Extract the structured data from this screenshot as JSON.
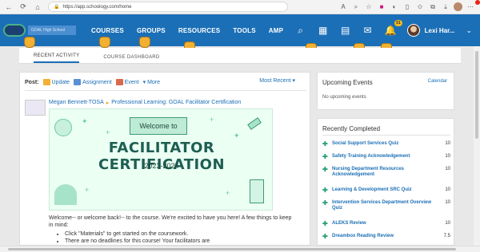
{
  "browser": {
    "url": "https://app.schoology.com/home",
    "nav": {
      "back": "←",
      "refresh": "⟳",
      "home": "⌂"
    }
  },
  "header": {
    "logo_text": "GOAL High School",
    "nav": [
      "COURSES",
      "GROUPS",
      "RESOURCES",
      "TOOLS",
      "AMP"
    ],
    "notification_count": "51",
    "user_name": "Lexi Har..."
  },
  "tabs": [
    "RECENT ACTIVITY",
    "COURSE DASHBOARD"
  ],
  "post": {
    "label": "Post:",
    "update": "Update",
    "assignment": "Assignment",
    "event": "Event",
    "more": "More",
    "sort": "Most Recent",
    "author": "Megan Bennett-TOSA",
    "arrow": "▸",
    "target": "Professional Learning: GOAL Facilitator Certification",
    "image": {
      "welcome": "Welcome to",
      "title": "FACILITATOR CERTIFICATION",
      "years": "2023-2024"
    },
    "intro": "Welcome-- or welcome back!-- to the course. We're excited to have you here! A few things to keep in mind:",
    "bullets": [
      "Click \"Materials\" to get started on the coursework.",
      "There are no deadlines for this course! Your facilitators are"
    ]
  },
  "upcoming": {
    "title": "Upcoming Events",
    "calendar_link": "Calendar",
    "empty": "No upcoming events"
  },
  "recently_completed": {
    "title": "Recently Completed",
    "items": [
      {
        "name": "Social Support Services Quiz",
        "score": "10"
      },
      {
        "name": "Safety Training Acknowledgement",
        "score": "10"
      },
      {
        "name": "Nursing Department Resources Acknowledgement",
        "score": "10"
      },
      {
        "name": "Learning & Development SRC Quiz",
        "score": "10"
      },
      {
        "name": "Intervention Services Department Overview Quiz",
        "score": "10"
      },
      {
        "name": "ALEKS Review",
        "score": "10"
      },
      {
        "name": "Dreambox Reading Review",
        "score": "7.5"
      }
    ]
  },
  "colors": {
    "header_bg": "#1b6fb6",
    "link": "#1b6fb6",
    "badge": "#f2b81c",
    "pointer": "#f2b133",
    "check_icon": "#2aa07b"
  }
}
